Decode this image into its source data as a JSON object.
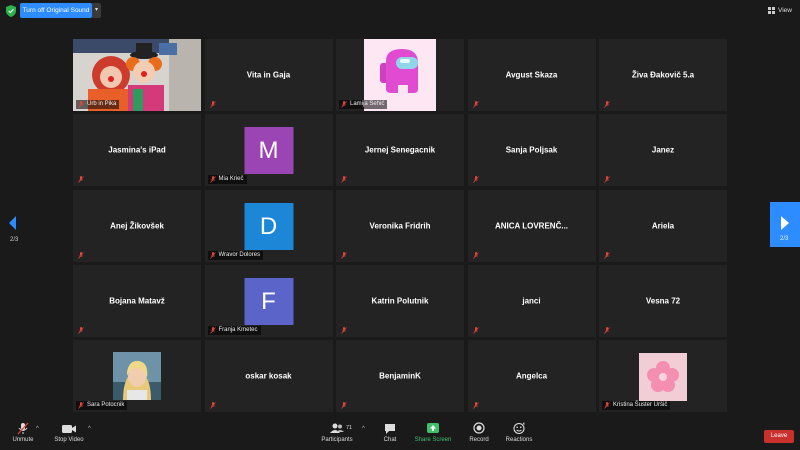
{
  "top": {
    "sound_button": "Turn off Original Sound",
    "view_label": "View"
  },
  "tiles": [
    {
      "label": "Urb in Pika",
      "type": "photo"
    },
    {
      "name": "Vita in Gaja"
    },
    {
      "label": "Lamija Šehić",
      "type": "amongus"
    },
    {
      "name": "Avgust Skaza"
    },
    {
      "name": "Živa Đakovič 5.a"
    },
    {
      "name": "Jasmina's iPad"
    },
    {
      "label": "Mia Krieč",
      "avatar_letter": "M",
      "avatar_color": "#9b44b4"
    },
    {
      "name": "Jernej Senegacnik"
    },
    {
      "name": "Sanja Poljsak"
    },
    {
      "name": "Janez"
    },
    {
      "name": "Anej Žikovšek"
    },
    {
      "label": "Wravor Dolores",
      "avatar_letter": "D",
      "avatar_color": "#1b87d6"
    },
    {
      "name": "Veronika Fridrih"
    },
    {
      "name": "ANICA  LOVRENČ..."
    },
    {
      "name": "Ariela"
    },
    {
      "name": "Bojana Matavž"
    },
    {
      "label": "Franja Kmetec",
      "avatar_letter": "F",
      "avatar_color": "#5b64c9"
    },
    {
      "name": "Katrin Polutnik"
    },
    {
      "name": "janci"
    },
    {
      "name": "Vesna 72"
    },
    {
      "label": "Sara Potocnik",
      "type": "sara"
    },
    {
      "name": "oskar kosak"
    },
    {
      "name": "BenjaminK"
    },
    {
      "name": "Angelca"
    },
    {
      "label": "Kristina Šuster Uršič",
      "type": "flower"
    }
  ],
  "nav": {
    "left_page": "2/3",
    "right_page": "2/3"
  },
  "toolbar": {
    "unmute": "Unmute",
    "stop_video": "Stop Video",
    "participants": "Participants",
    "participants_count": "71",
    "chat": "Chat",
    "share_screen": "Share Screen",
    "record": "Record",
    "reactions": "Reactions",
    "leave": "Leave"
  },
  "colors": {
    "accent": "#2d8cff",
    "share_green": "#3fc06b",
    "leave_red": "#c9302c",
    "muted_red": "#e0443a"
  }
}
